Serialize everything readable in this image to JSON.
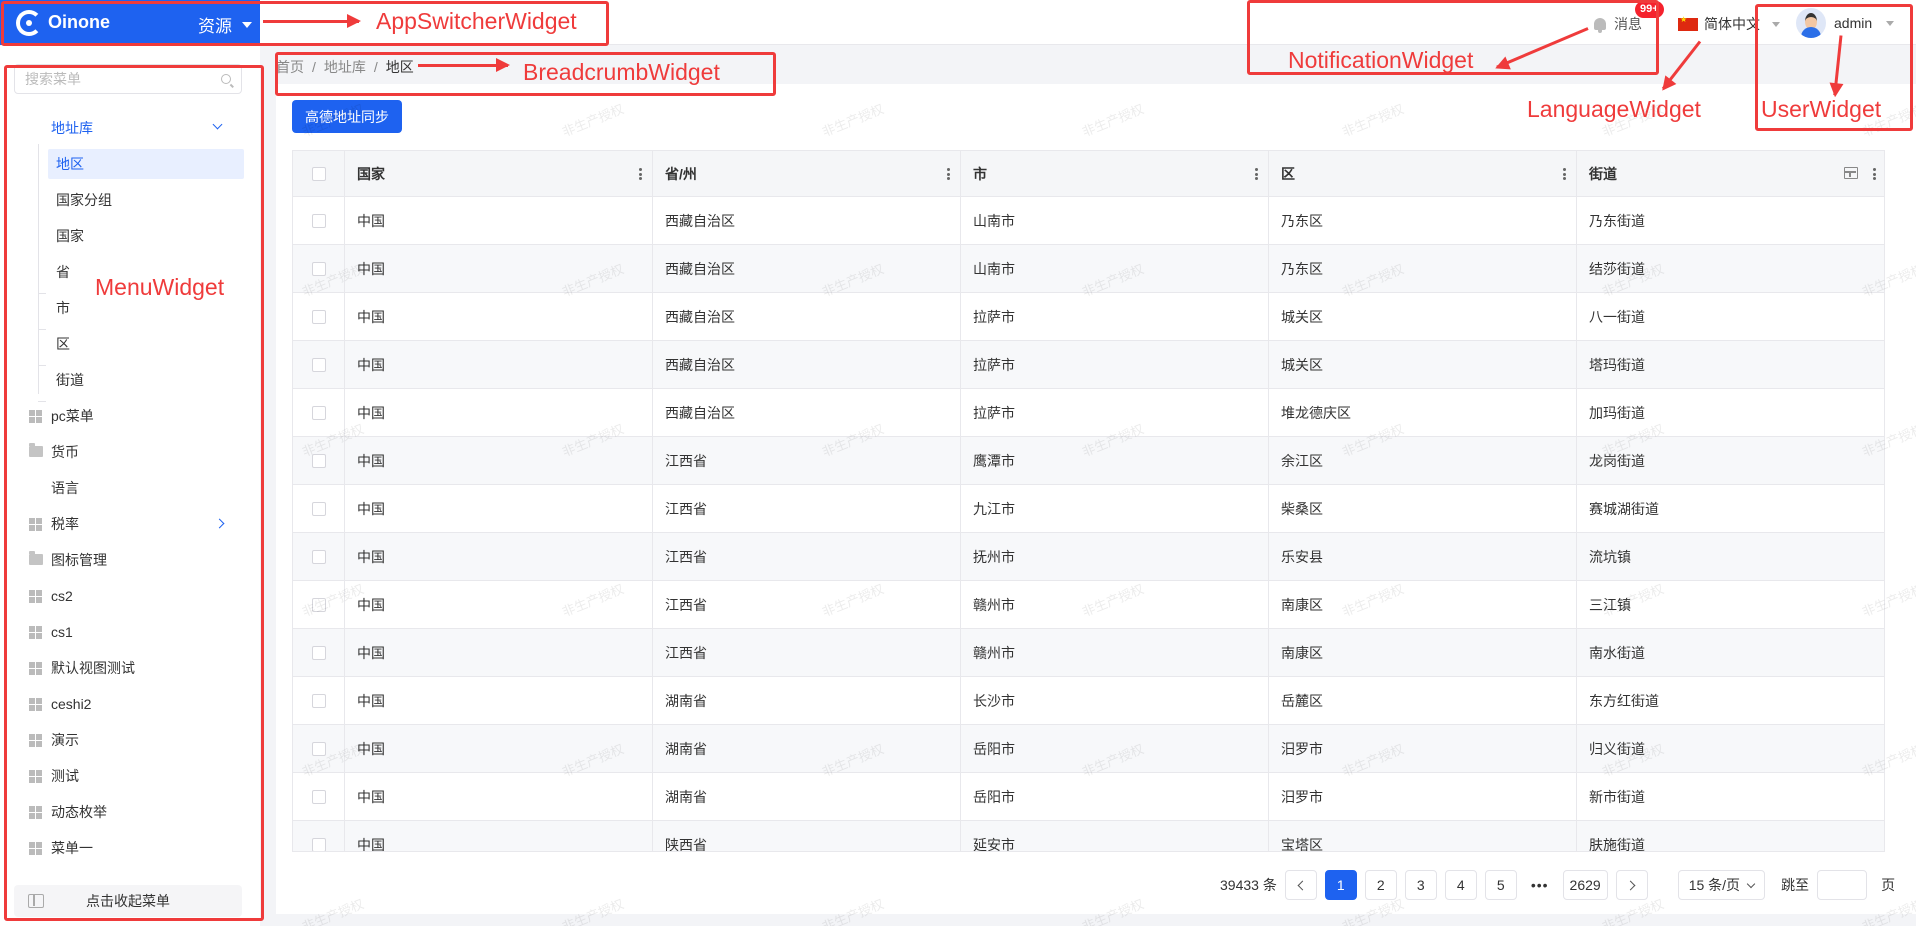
{
  "header": {
    "logo_text": "Oinone",
    "app_name": "资源",
    "notification_label": "消息",
    "notification_badge": "99+",
    "language_label": "简体中文",
    "user_name": "admin"
  },
  "sidebar": {
    "search_placeholder": "搜索菜单",
    "group_label": "地址库",
    "sub_items": [
      "地区",
      "国家分组",
      "国家",
      "省",
      "市",
      "区",
      "街道"
    ],
    "items": [
      {
        "label": "pc菜单",
        "icon": "grid-icon"
      },
      {
        "label": "货币",
        "icon": "folder-icon"
      },
      {
        "label": "语言",
        "icon": ""
      },
      {
        "label": "税率",
        "icon": "grid-icon"
      },
      {
        "label": "图标管理",
        "icon": "folder-icon"
      },
      {
        "label": "cs2",
        "icon": "grid-icon"
      },
      {
        "label": "cs1",
        "icon": "grid-icon"
      },
      {
        "label": "默认视图测试",
        "icon": "grid-icon"
      },
      {
        "label": "ceshi2",
        "icon": "grid-icon"
      },
      {
        "label": "演示",
        "icon": "grid-icon"
      },
      {
        "label": "测试",
        "icon": "grid-icon"
      },
      {
        "label": "动态枚举",
        "icon": "grid-icon"
      },
      {
        "label": "菜单一",
        "icon": "grid-icon"
      }
    ],
    "collapse_label": "点击收起菜单"
  },
  "breadcrumb": [
    "首页",
    "地址库",
    "地区"
  ],
  "toolbar": {
    "sync_label": "高德地址同步"
  },
  "table": {
    "columns": [
      "国家",
      "省/州",
      "市",
      "区",
      "街道"
    ],
    "rows": [
      [
        "中国",
        "西藏自治区",
        "山南市",
        "乃东区",
        "乃东街道"
      ],
      [
        "中国",
        "西藏自治区",
        "山南市",
        "乃东区",
        "结莎街道"
      ],
      [
        "中国",
        "西藏自治区",
        "拉萨市",
        "城关区",
        "八一街道"
      ],
      [
        "中国",
        "西藏自治区",
        "拉萨市",
        "城关区",
        "塔玛街道"
      ],
      [
        "中国",
        "西藏自治区",
        "拉萨市",
        "堆龙德庆区",
        "加玛街道"
      ],
      [
        "中国",
        "江西省",
        "鹰潭市",
        "余江区",
        "龙岗街道"
      ],
      [
        "中国",
        "江西省",
        "九江市",
        "柴桑区",
        "赛城湖街道"
      ],
      [
        "中国",
        "江西省",
        "抚州市",
        "乐安县",
        "流坑镇"
      ],
      [
        "中国",
        "江西省",
        "赣州市",
        "南康区",
        "三江镇"
      ],
      [
        "中国",
        "江西省",
        "赣州市",
        "南康区",
        "南水街道"
      ],
      [
        "中国",
        "湖南省",
        "长沙市",
        "岳麓区",
        "东方红街道"
      ],
      [
        "中国",
        "湖南省",
        "岳阳市",
        "汨罗市",
        "归义街道"
      ],
      [
        "中国",
        "湖南省",
        "岳阳市",
        "汨罗市",
        "新市街道"
      ],
      [
        "中国",
        "陕西省",
        "延安市",
        "宝塔区",
        "肤施街道"
      ]
    ]
  },
  "pagination": {
    "total": "39433 条",
    "pages": [
      "1",
      "2",
      "3",
      "4",
      "5"
    ],
    "current": "1",
    "ellipsis": "•••",
    "last_page": "2629",
    "page_size": "15 条/页",
    "jump_label": "跳至",
    "page_suffix": "页"
  },
  "watermark_text": "非生产授权",
  "annotations": {
    "app_switcher": "AppSwitcherWidget",
    "breadcrumb": "BreadcrumbWidget",
    "menu": "MenuWidget",
    "notification": "NotificationWidget",
    "language": "LanguageWidget",
    "user": "UserWidget",
    "color": "#ef3b3b"
  },
  "colors": {
    "primary": "#1e62f0",
    "annotation": "#ef3b3b",
    "badge": "#f5222d"
  }
}
